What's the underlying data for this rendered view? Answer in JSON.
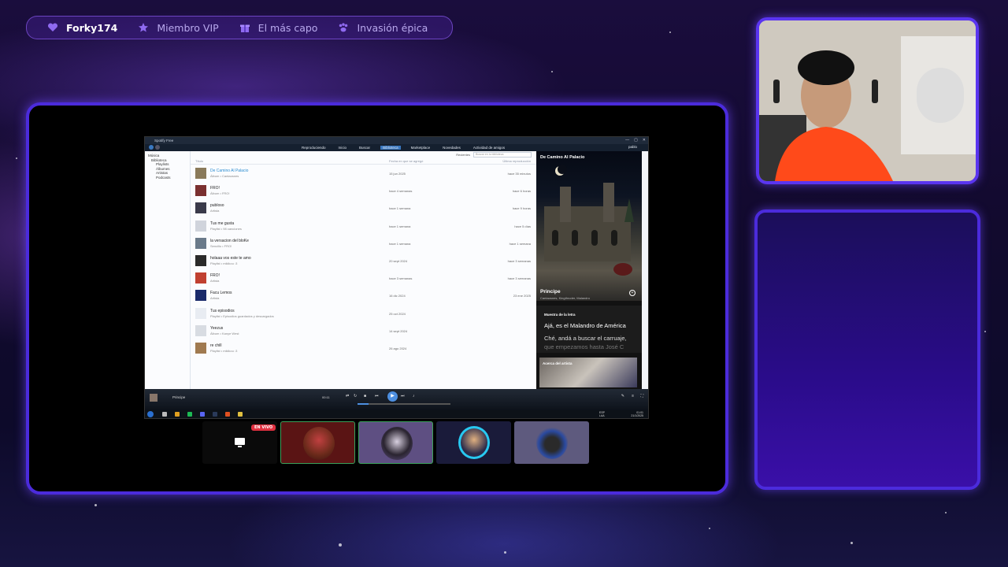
{
  "overlay": {
    "items": [
      {
        "icon": "heart-icon",
        "label": "Forky174"
      },
      {
        "icon": "star-icon",
        "label": "Miembro VIP"
      },
      {
        "icon": "gift-icon",
        "label": "El más capo"
      },
      {
        "icon": "paw-icon",
        "label": "Invasión épica"
      }
    ],
    "accent": "#4b2bdc"
  },
  "spotify": {
    "window_title": "Spotify Free",
    "menu": [
      "Reproduciendo",
      "Inicio",
      "Buscar",
      "Biblioteca",
      "Marketplace",
      "Novedades",
      "Actividad de amigos"
    ],
    "active_menu": "Biblioteca",
    "user": "pablo",
    "sidebar": {
      "root": "Música",
      "library": "Biblioteca",
      "items": [
        "Playlists",
        "Álbumes",
        "Artistas",
        "Podcasts"
      ]
    },
    "search": {
      "sort_label": "Recientes",
      "placeholder": "Buscar en tu biblioteca"
    },
    "columns": {
      "title": "Título",
      "date_added": "Fecha en que se agregó",
      "last_played": "Última reproducción"
    },
    "rows": [
      {
        "title": "De Camino Al Palacio",
        "sub": "Álbum • Cantaosnes",
        "date": "15 jun 2025",
        "last": "hace 35 minutos",
        "color": "#8a7a5a"
      },
      {
        "title": "FRO!",
        "sub": "Álbum • FRO!",
        "date": "hace 4 semanas",
        "last": "hace 6 horas",
        "color": "#7a3030"
      },
      {
        "title": "publoso",
        "sub": "Artista",
        "date": "hace 1 semana",
        "last": "hace 9 horas",
        "color": "#3a3a4a"
      },
      {
        "title": "Tus me gusta",
        "sub": "Playlist • 98 canciones",
        "date": "hace 1 semana",
        "last": "hace 5 días",
        "color": "#d0d4dc"
      },
      {
        "title": "la versacion del bloKe",
        "sub": "Sencillo • FRO!",
        "date": "hace 1 semana",
        "last": "hace 1 semana",
        "color": "#6a7a8a"
      },
      {
        "title": "holaaa vos este te amo",
        "sub": "Playlist • mikikou :3",
        "date": "20 sept 2024",
        "last": "hace 3 semanas",
        "color": "#2a2a2a"
      },
      {
        "title": "FRO!",
        "sub": "Artista",
        "date": "hace 3 semanas",
        "last": "hace 3 semanas",
        "color": "#c04030"
      },
      {
        "title": "Facu Lemos",
        "sub": "Artista",
        "date": "16 dic 2024",
        "last": "23 ene 2025",
        "color": "#1a2a6a"
      },
      {
        "title": "Tus episodios",
        "sub": "Playlist • Episodios guardados y descargados",
        "date": "25 oct 2024",
        "last": "",
        "color": "#e8ecf2"
      },
      {
        "title": "Yeezus",
        "sub": "Álbum • Kanye West",
        "date": "14 sept 2024",
        "last": "",
        "color": "#d8dce2"
      },
      {
        "title": "re chill",
        "sub": "Playlist • mikikou :3",
        "date": "26 ago 2024",
        "last": "",
        "color": "#a07a50"
      }
    ],
    "now_playing_panel": {
      "album": "De Camino Al Palacio",
      "song": "Principe",
      "artists": "Cantaosnes, Kingthroder, Malandro",
      "lyrics_header": "Muestra de la letra",
      "lyrics": [
        "Ajá, es el Malandro de América",
        "Ché, andá a buscar el carruaje,",
        "que empezamos hasta José C"
      ],
      "about": "Acerca del artista"
    },
    "player": {
      "song": "Principe",
      "time": "00:11",
      "progress": 0.12
    },
    "taskbar": {
      "lang": "ESP LAA",
      "time": "01:01",
      "date": "21/1/2025"
    }
  },
  "participants": {
    "live_label": "EN VIVO",
    "tiles": [
      {
        "kind": "screen"
      },
      {
        "kind": "avatar",
        "color": "#6a2a1a"
      },
      {
        "kind": "avatar",
        "color": "#2a2430"
      },
      {
        "kind": "avatar",
        "color": "#28c8f0"
      },
      {
        "kind": "avatar",
        "color": "#2a4aa0"
      }
    ]
  }
}
